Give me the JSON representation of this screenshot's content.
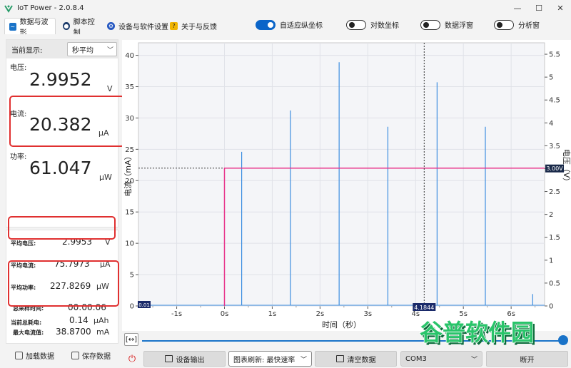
{
  "window": {
    "title": "IoT Power - 2.0.8.4",
    "minimize": "—",
    "maximize": "☐",
    "close": "✕"
  },
  "tabs": [
    {
      "label": "数据与波形",
      "active": true
    },
    {
      "label": "脚本控制"
    },
    {
      "label": "设备与软件设置"
    },
    {
      "label": "关于与反馈"
    }
  ],
  "toggles": [
    {
      "label": "自适应纵坐标",
      "on": true
    },
    {
      "label": "对数坐标",
      "on": false
    },
    {
      "label": "数据浮窗",
      "on": false
    },
    {
      "label": "分析窗",
      "on": false
    }
  ],
  "display": {
    "label": "当前显示:",
    "mode": "秒平均",
    "chev": "﹀"
  },
  "metrics": {
    "voltage": {
      "label": "电压:",
      "value": "2.9952",
      "unit": "V"
    },
    "current": {
      "label": "电流:",
      "value": "20.382",
      "unit": "μA"
    },
    "power": {
      "label": "功率:",
      "value": "61.047",
      "unit": "μW"
    }
  },
  "summary": {
    "avg_voltage": {
      "label": "平均电压:",
      "value": "2.9953",
      "unit": "V"
    },
    "avg_current": {
      "label": "平均电流:",
      "value": "75.7973",
      "unit": "μA"
    },
    "avg_power": {
      "label": "平均功率:",
      "value": "227.8269",
      "unit": "μW"
    },
    "total_energy": {
      "label": "当前总耗电:",
      "value": "0.14",
      "unit": "μAh"
    },
    "sample_time": {
      "label": "总采样时间:",
      "value": "00:00:06"
    },
    "max_current": {
      "label": "最大电流值:",
      "value": "38.8700",
      "unit": "mA"
    }
  },
  "buttons": {
    "load_data": "加载数据",
    "save_data": "保存数据",
    "device_output": "设备输出",
    "clear_data": "清空数据",
    "disconnect": "断开",
    "expand": "[↔]",
    "power": "⏻"
  },
  "refresh": {
    "label": "图表刷新:",
    "value": "最快速率",
    "chev": "﹀"
  },
  "port": {
    "value": "COM3",
    "chev": "﹀"
  },
  "chart_data": {
    "type": "line",
    "xlabel": "时间（秒）",
    "ylabel_left": "电流（mA）",
    "ylabel_right": "电压（V）",
    "xlim": [
      -1.8,
      6.7
    ],
    "ylim_left": [
      0,
      42
    ],
    "ylim_right": [
      0,
      5.75
    ],
    "x_ticks": [
      "-1s",
      "0s",
      "1s",
      "2s",
      "3s",
      "4s",
      "5s",
      "6s"
    ],
    "x_tick_values": [
      -1,
      0,
      1,
      2,
      3,
      4,
      5,
      6
    ],
    "y_ticks_left": [
      0,
      5,
      10,
      15,
      20,
      25,
      30,
      35,
      40
    ],
    "y_ticks_right": [
      0,
      0.5,
      1,
      1.5,
      2,
      2.5,
      3,
      3.5,
      4,
      4.5,
      5,
      5.5
    ],
    "grid": true,
    "series": [
      {
        "color": "#3d8ee0",
        "axis": "left",
        "spikes": [
          {
            "x": 0.36,
            "y": 24.6
          },
          {
            "x": 1.38,
            "y": 31.2
          },
          {
            "x": 2.4,
            "y": 38.9
          },
          {
            "x": 3.42,
            "y": 28.6
          },
          {
            "x": 4.45,
            "y": 35.7
          },
          {
            "x": 5.46,
            "y": 28.6
          },
          {
            "x": 6.45,
            "y": 1.9
          }
        ]
      },
      {
        "color": "#e8338a",
        "axis": "left",
        "step": {
          "x0": 0,
          "level": 22
        }
      }
    ],
    "cursor": {
      "x": 4.18,
      "label": "4.1844"
    },
    "y_cursor_left": {
      "value": 22,
      "label": "0.01"
    },
    "y_cursor_right": {
      "label": "3.00V"
    }
  },
  "watermark": "谷普软件园"
}
